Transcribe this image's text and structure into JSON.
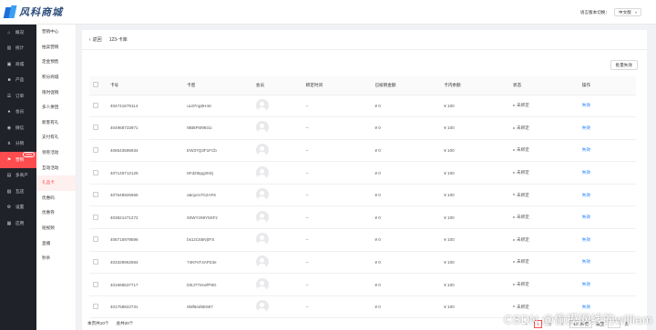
{
  "brand": {
    "name": "风科商城"
  },
  "topbar": {
    "lang_label": "语言版本切换：",
    "lang_value": "中文版"
  },
  "nav": [
    {
      "icon": "home-icon",
      "glyph": "⌂",
      "label": "概况"
    },
    {
      "icon": "stats-icon",
      "glyph": "▥",
      "label": "统计"
    },
    {
      "icon": "shop-icon",
      "glyph": "▣",
      "label": "商城"
    },
    {
      "icon": "product-icon",
      "glyph": "■",
      "label": "产品"
    },
    {
      "icon": "order-icon",
      "glyph": "☰",
      "label": "订单"
    },
    {
      "icon": "member-icon",
      "glyph": "●",
      "label": "会员"
    },
    {
      "icon": "wechat-icon",
      "glyph": "◉",
      "label": "微信"
    },
    {
      "icon": "distribution-icon",
      "glyph": "⋔",
      "label": "分销"
    },
    {
      "icon": "marketing-icon",
      "glyph": "⚑",
      "label": "营销",
      "badge": "new"
    },
    {
      "icon": "multi-store-icon",
      "glyph": "▤",
      "label": "多商户"
    },
    {
      "icon": "kuaisu-icon",
      "glyph": "▧",
      "label": "瓦店"
    },
    {
      "icon": "settings-icon",
      "glyph": "⚙",
      "label": "设置"
    },
    {
      "icon": "apps-icon",
      "glyph": "▦",
      "label": "应用"
    }
  ],
  "subnav": [
    "营销中心",
    "拍卖营销",
    "定金预售",
    "积分商城",
    "限时促销",
    "多人拼团",
    "新客有礼",
    "支付有礼",
    "领劵活动",
    "互动活动",
    "礼品卡",
    "优惠码",
    "优惠券",
    "短视频",
    "直播",
    "秒杀"
  ],
  "page": {
    "back_label": "返回",
    "title": "123-卡库"
  },
  "toolbar": {
    "batch_label": "批量失效"
  },
  "table": {
    "headers": [
      "",
      "卡号",
      "卡密",
      "会员",
      "绑定时间",
      "已核销金额",
      "卡内余额",
      "状态",
      "操作"
    ],
    "rows": [
      {
        "card": "404741679114",
        "pwd": "uL87ng8H4Ic",
        "time": "--",
        "used": "¥ 0",
        "balance": "¥ 100",
        "status": "未绑定",
        "action": "失效"
      },
      {
        "card": "404968733971",
        "pwd": "9Bt8FM9931i",
        "time": "--",
        "used": "¥ 0",
        "balance": "¥ 100",
        "status": "未绑定",
        "action": "失效"
      },
      {
        "card": "406543595934",
        "pwd": "EW37Q3F1FCb",
        "time": "--",
        "used": "¥ 0",
        "balance": "¥ 100",
        "status": "未绑定",
        "action": "失效"
      },
      {
        "card": "407149712126",
        "pwd": "6Fd2t5pg2K8j",
        "time": "--",
        "used": "¥ 0",
        "balance": "¥ 100",
        "status": "未绑定",
        "action": "失效"
      },
      {
        "card": "407548926655",
        "pwd": "a6cpcs7G2AF6",
        "time": "--",
        "used": "¥ 0",
        "balance": "¥ 100",
        "status": "未绑定",
        "action": "失效"
      },
      {
        "card": "403821471272",
        "pwd": "92WYz69Y5SFz",
        "time": "--",
        "used": "¥ 0",
        "balance": "¥ 100",
        "status": "未绑定",
        "action": "失效"
      },
      {
        "card": "406715979596",
        "pwd": "bs1zC65N)tFS",
        "time": "--",
        "used": "¥ 0",
        "balance": "¥ 100",
        "status": "未绑定",
        "action": "失效"
      },
      {
        "card": "403328962584",
        "pwd": "74KFsT4AP23e",
        "time": "--",
        "used": "¥ 0",
        "balance": "¥ 100",
        "status": "未绑定",
        "action": "失效"
      },
      {
        "card": "401668537717",
        "pwd": "DEJ77SnefP8G",
        "time": "--",
        "used": "¥ 0",
        "balance": "¥ 100",
        "status": "未绑定",
        "action": "失效"
      },
      {
        "card": "401758822731",
        "pwd": "9Mf6ed5E697",
        "time": "--",
        "used": "¥ 0",
        "balance": "¥ 100",
        "status": "未绑定",
        "action": "失效"
      }
    ]
  },
  "footer": {
    "page_info": "本页共10个",
    "total_info": "总共20个"
  },
  "pager": {
    "prev": "‹",
    "pages": [
      "1",
      "2"
    ],
    "next": "›",
    "size": "10 条/页",
    "jump_label": "跳至",
    "jump_suffix": "页"
  },
  "watermark": "CSDN @偷摸网线的william",
  "colors": {
    "accent": "#ff4d4f",
    "link": "#1677ff",
    "nav_bg": "#20222a"
  }
}
